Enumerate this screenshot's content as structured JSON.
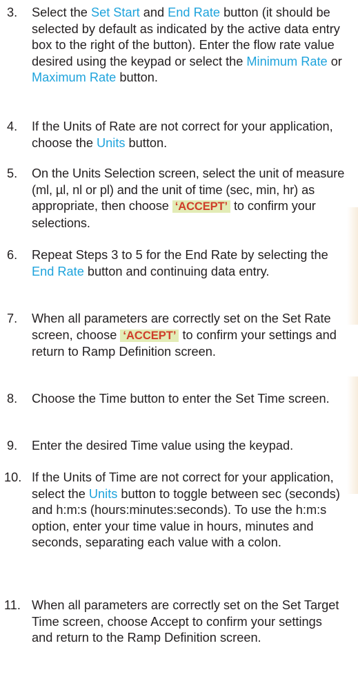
{
  "steps": [
    {
      "num": "3.",
      "p1": "Select the ",
      "l1": "Set Start",
      "p2": " and ",
      "l2": "End Rate",
      "p3": " button (it should be selected by default as indicated by the active data entry box to the right of the button). Enter the flow rate value desired using the keypad or select the ",
      "l3": "Minimum Rate",
      "p4": " or ",
      "l4": "Maximum Rate",
      "p5": " button."
    },
    {
      "num": "4.",
      "p1": "If the Units of Rate are not correct for your application, choose the ",
      "l1": "Units",
      "p2": " button."
    },
    {
      "num": "5.",
      "p1": "On the Units Selection screen, select the unit of measure (ml, µl, nl or pl) and the unit of time (sec, min, hr) as appropriate, then choose ",
      "accept": "‘ACCEPT’",
      "p2": " to confirm your selections."
    },
    {
      "num": "6.",
      "p1": "Repeat Steps 3 to 5 for the End Rate by selecting the ",
      "l1": "End Rate",
      "p2": " button and continuing data entry."
    },
    {
      "num": "7.",
      "p1": "When all parameters are correctly set on the Set Rate screen, choose ",
      "accept": "‘ACCEPT’",
      "p2": " to confirm your settings and return to Ramp Definition screen."
    },
    {
      "num": "8.",
      "p1": "Choose the Time button to enter the Set Time screen."
    },
    {
      "num": "9.",
      "p1": "Enter the desired Time value using the keypad."
    },
    {
      "num": "10.",
      "p1": "If the Units of Time are not correct for your application, select the ",
      "l1": "Units",
      "p2": " button to toggle between sec (seconds) and h:m:s (hours:minutes:seconds). To use the h:m:s option, enter your time value in hours, minutes and seconds, separating each value with a colon."
    },
    {
      "num": "11.",
      "p1": "When all parameters are correctly set on the Set Target Time screen, choose Accept to confirm your settings and return to the Ramp Definition screen."
    }
  ],
  "colors": {
    "link": "#1ea3dc",
    "accept_text": "#cf3e2a",
    "accept_bg": "#e3ecb6",
    "body_text": "#231f20"
  }
}
